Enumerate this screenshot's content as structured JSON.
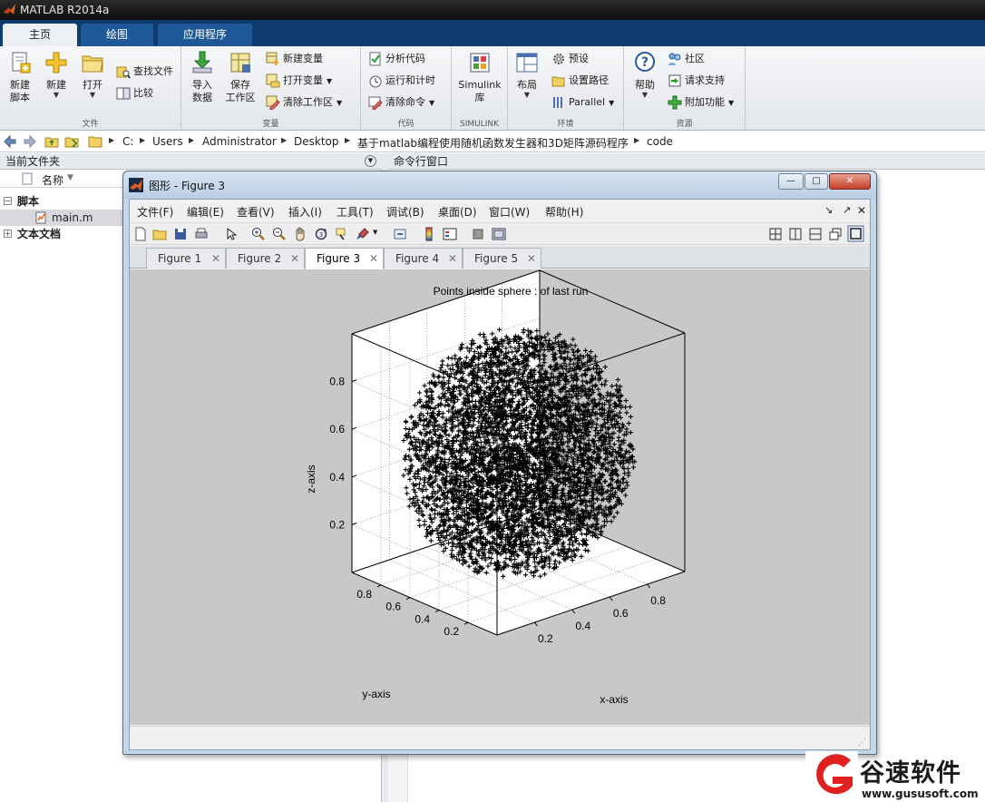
{
  "app": {
    "title": "MATLAB R2014a",
    "tabs": [
      {
        "label": "主页"
      },
      {
        "label": "绘图"
      },
      {
        "label": "应用程序"
      }
    ]
  },
  "ribbon": {
    "file": {
      "label": "文件",
      "new_script": [
        "新建",
        "脚本"
      ],
      "new": "新建",
      "open": "打开",
      "find_files": "查找文件",
      "compare": "比较"
    },
    "variable": {
      "label": "变量",
      "import": [
        "导入",
        "数据"
      ],
      "save_workspace": [
        "保存",
        "工作区"
      ],
      "new_variable": "新建变量",
      "open_variable": "打开变量",
      "clear_workspace": "清除工作区"
    },
    "code": {
      "label": "代码",
      "analyze": "分析代码",
      "run_time": "运行和计时",
      "clear_commands": "清除命令"
    },
    "simulink": {
      "label": "SIMULINK",
      "lib": [
        "Simulink",
        "库"
      ]
    },
    "env": {
      "label": "环境",
      "layout": "布局",
      "prefs": "预设",
      "set_path": "设置路径",
      "parallel": "Parallel"
    },
    "resources": {
      "label": "资源",
      "help": "帮助",
      "community": "社区",
      "support": "请求支持",
      "addons": "附加功能"
    }
  },
  "address": {
    "crumbs": [
      "C:",
      "Users",
      "Administrator",
      "Desktop",
      "基于matlab编程使用随机函数发生器和3D矩阵源码程序",
      "code"
    ]
  },
  "folder_panel": {
    "title": "当前文件夹",
    "col_name": "名称",
    "items": [
      {
        "label": "脚本"
      },
      {
        "label": "main.m"
      },
      {
        "label": "文本文档"
      }
    ]
  },
  "command_window": {
    "title": "命令行窗口"
  },
  "figure": {
    "title": "图形 - Figure 3",
    "menus": [
      "文件(F)",
      "编辑(E)",
      "查看(V)",
      "插入(I)",
      "工具(T)",
      "调试(B)",
      "桌面(D)",
      "窗口(W)",
      "帮助(H)"
    ],
    "tabs": [
      "Figure 1",
      "Figure 2",
      "Figure 3",
      "Figure 4",
      "Figure 5"
    ],
    "active_tab": 2
  },
  "chart_data": {
    "type": "scatter",
    "title": "Points inside sphere : of last run",
    "xlabel": "x-axis",
    "ylabel": "y-axis",
    "zlabel": "z-axis",
    "xlim": [
      0,
      1
    ],
    "ylim": [
      0,
      1
    ],
    "zlim": [
      0,
      1
    ],
    "x_ticks": [
      "0.2",
      "0.4",
      "0.6",
      "0.8"
    ],
    "y_ticks": [
      "0.2",
      "0.4",
      "0.6",
      "0.8"
    ],
    "z_ticks": [
      "0.2",
      "0.4",
      "0.6",
      "0.8"
    ],
    "grid": true,
    "marker": "+",
    "marker_color": "#000000",
    "sphere_center": [
      0.5,
      0.5,
      0.5
    ],
    "sphere_radius": 0.5
  },
  "watermark": {
    "brand": "谷速软件",
    "url": "www.gususoft.com"
  }
}
